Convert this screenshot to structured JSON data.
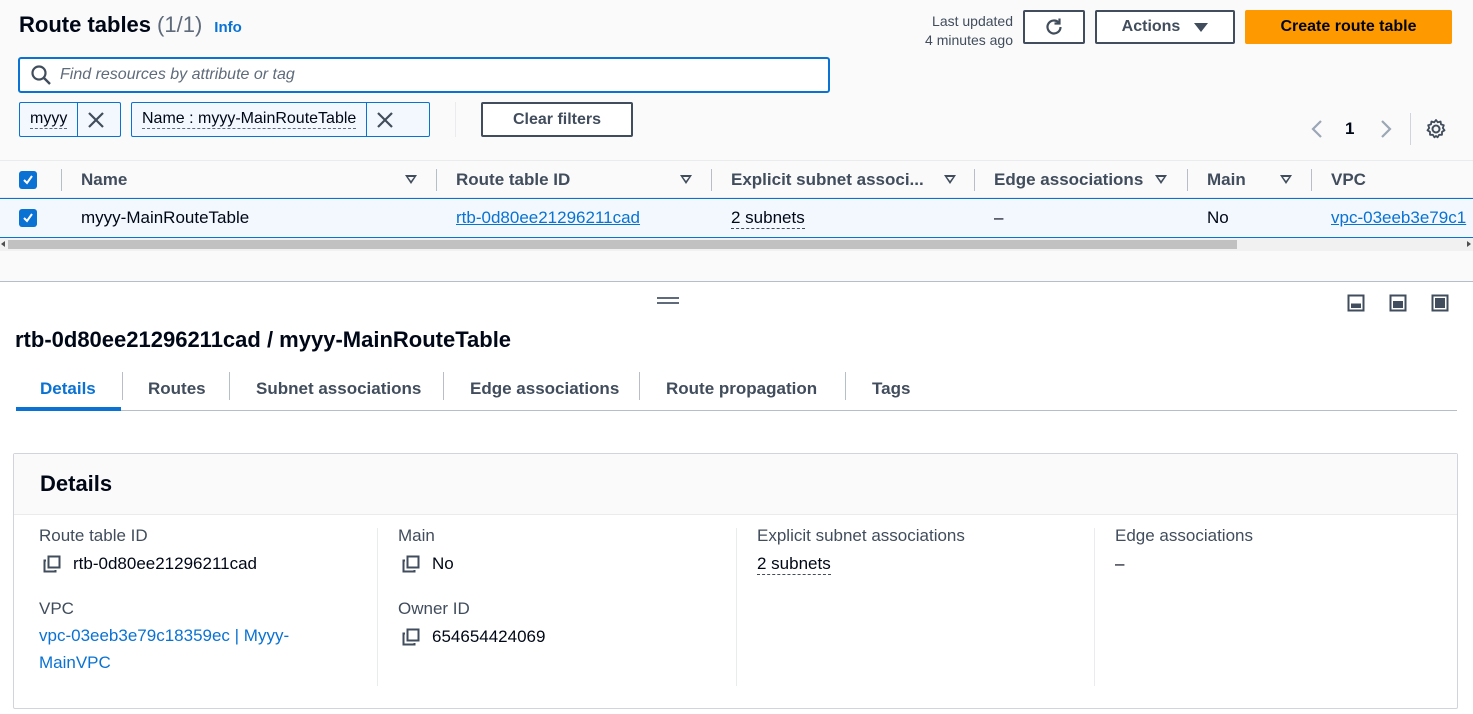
{
  "header": {
    "title": "Route tables",
    "count": "(1/1)",
    "info": "Info",
    "last_updated_line1": "Last updated",
    "last_updated_line2": "4 minutes ago",
    "actions_label": "Actions",
    "create_label": "Create route table"
  },
  "search": {
    "placeholder": "Find resources by attribute or tag"
  },
  "filters": {
    "tokens": [
      "myyy",
      "Name : myyy-MainRouteTable"
    ],
    "clear_label": "Clear filters"
  },
  "pagination": {
    "page": "1"
  },
  "table": {
    "columns": [
      "Name",
      "Route table ID",
      "Explicit subnet associ...",
      "Edge associations",
      "Main",
      "VPC"
    ],
    "rows": [
      {
        "name": "myyy-MainRouteTable",
        "route_table_id": "rtb-0d80ee21296211cad",
        "explicit_subnets": "2 subnets",
        "edge": "–",
        "main": "No",
        "vpc": "vpc-03eeb3e79c1"
      }
    ]
  },
  "detail": {
    "title": "rtb-0d80ee21296211cad / myyy-MainRouteTable",
    "tabs": [
      "Details",
      "Routes",
      "Subnet associations",
      "Edge associations",
      "Route propagation",
      "Tags"
    ],
    "panel_title": "Details",
    "fields": {
      "route_table_id_label": "Route table ID",
      "route_table_id": "rtb-0d80ee21296211cad",
      "vpc_label": "VPC",
      "vpc_line1": "vpc-03eeb3e79c18359ec | Myyy-",
      "vpc_line2": "MainVPC",
      "main_label": "Main",
      "main": "No",
      "owner_label": "Owner ID",
      "owner": "654654424069",
      "explicit_label": "Explicit subnet associations",
      "explicit": "2 subnets",
      "edge_label": "Edge associations",
      "edge": "–"
    }
  },
  "colors": {
    "accent": "#0972d3",
    "primary_button": "#ff9900",
    "text": "#000716",
    "secondary_text": "#414d5c"
  },
  "icons": [
    "search-icon",
    "refresh-icon",
    "close-icon",
    "chevron-left-icon",
    "chevron-right-icon",
    "gear-icon",
    "copy-icon",
    "drag-handle-icon",
    "panel-bottom-icon",
    "panel-side-icon",
    "panel-full-icon"
  ]
}
